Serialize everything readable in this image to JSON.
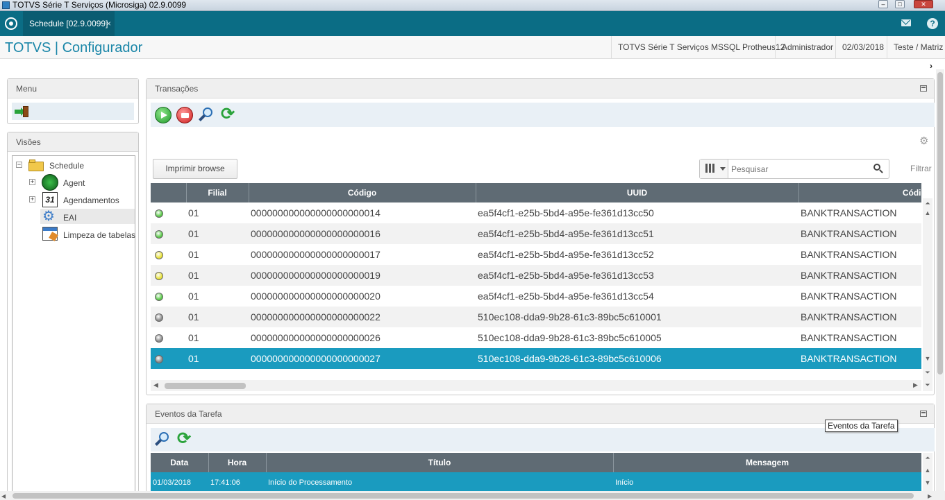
{
  "window": {
    "title": "TOTVS Série T Serviços (Microsiga) 02.9.0099"
  },
  "tabs": [
    {
      "label": "Schedule [02.9.0099]",
      "close": "×"
    }
  ],
  "header": {
    "app_title": "TOTVS | Configurador",
    "environment": "TOTVS Série T Serviços MSSQL Protheus12",
    "user": "Administrador",
    "date": "02/03/2018",
    "company": "Teste / Matriz"
  },
  "menu_panel": {
    "title": "Menu"
  },
  "visoes_panel": {
    "title": "Visões",
    "tree": [
      {
        "label": "Schedule",
        "icon": "folder-icon"
      },
      {
        "label": "Agent",
        "icon": "radar-icon"
      },
      {
        "label": "Agendamentos",
        "icon": "calendar-icon"
      },
      {
        "label": "EAI",
        "icon": "gears-icon",
        "selected": true
      },
      {
        "label": "Limpeza de tabelas",
        "icon": "table-clean-icon"
      }
    ]
  },
  "transacoes": {
    "title": "Transações",
    "print_button": "Imprimir browse",
    "search_placeholder": "Pesquisar",
    "filter_label": "Filtrar",
    "columns": [
      "",
      "Filial",
      "Código",
      "UUID",
      "Códi"
    ],
    "rows": [
      {
        "status": "green",
        "filial": "01",
        "codigo": "000000000000000000000014",
        "uuid": "ea5f4cf1-e25b-5bd4-a95e-fe361d13cc50",
        "codigo2": "BANKTRANSACTION"
      },
      {
        "status": "green",
        "filial": "01",
        "codigo": "000000000000000000000016",
        "uuid": "ea5f4cf1-e25b-5bd4-a95e-fe361d13cc51",
        "codigo2": "BANKTRANSACTION"
      },
      {
        "status": "yellow",
        "filial": "01",
        "codigo": "000000000000000000000017",
        "uuid": "ea5f4cf1-e25b-5bd4-a95e-fe361d13cc52",
        "codigo2": "BANKTRANSACTION"
      },
      {
        "status": "yellow",
        "filial": "01",
        "codigo": "000000000000000000000019",
        "uuid": "ea5f4cf1-e25b-5bd4-a95e-fe361d13cc53",
        "codigo2": "BANKTRANSACTION"
      },
      {
        "status": "green",
        "filial": "01",
        "codigo": "000000000000000000000020",
        "uuid": "ea5f4cf1-e25b-5bd4-a95e-fe361d13cc54",
        "codigo2": "BANKTRANSACTION"
      },
      {
        "status": "gray",
        "filial": "01",
        "codigo": "000000000000000000000022",
        "uuid": "510ec108-dda9-9b28-61c3-89bc5c610001",
        "codigo2": "BANKTRANSACTION"
      },
      {
        "status": "gray",
        "filial": "01",
        "codigo": "000000000000000000000026",
        "uuid": "510ec108-dda9-9b28-61c3-89bc5c610005",
        "codigo2": "BANKTRANSACTION"
      },
      {
        "status": "gray",
        "filial": "01",
        "codigo": "000000000000000000000027",
        "uuid": "510ec108-dda9-9b28-61c3-89bc5c610006",
        "codigo2": "BANKTRANSACTION",
        "selected": true
      }
    ]
  },
  "eventos": {
    "title": "Eventos da Tarefa",
    "tooltip": "Eventos da Tarefa",
    "columns": [
      "Data",
      "Hora",
      "Título",
      "Mensagem"
    ],
    "rows": [
      {
        "data": "01/03/2018",
        "hora": "17:41:06",
        "titulo": "Início do Processamento",
        "mensagem": "Início",
        "selected": true
      }
    ]
  },
  "colors": {
    "accent": "#0b6d85",
    "selected_row": "#1a9bbf",
    "header_bg": "#5f6b74",
    "green": "#5cc94a",
    "yellow": "#e6e03a",
    "gray": "#8c8c8c"
  }
}
